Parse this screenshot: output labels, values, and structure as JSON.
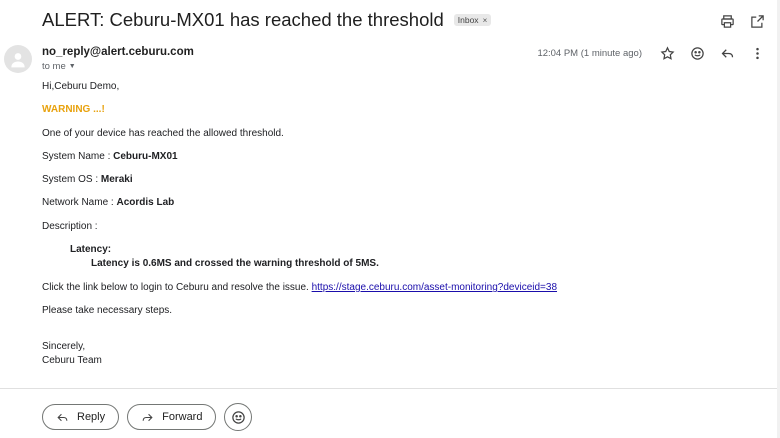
{
  "header": {
    "subject": "ALERT: Ceburu-MX01 has reached the threshold",
    "label_badge": "Inbox",
    "label_close": "×",
    "icons": [
      "print-icon",
      "open-in-new-window-icon"
    ]
  },
  "sender": {
    "email": "no_reply@alert.ceburu.com",
    "to_label": "to me",
    "time": "12:04 PM (1 minute ago)"
  },
  "body": {
    "greeting": "Hi,Ceburu Demo,",
    "warning": "WARNING ...!",
    "intro": "One of your device has reached the allowed threshold.",
    "system_name_label": "System Name : ",
    "system_name_value": "Ceburu-MX01",
    "system_os_label": "System OS : ",
    "system_os_value": "Meraki",
    "network_name_label": "Network Name : ",
    "network_name_value": "Acordis Lab",
    "description_label": "Description :",
    "latency_title": "Latency:",
    "latency_text": "Latency is 0.6MS and crossed the warning threshold of 5MS.",
    "link_prefix": "Click the link below to login to Ceburu and resolve the issue. ",
    "link_url": "https://stage.ceburu.com/asset-monitoring?deviceid=38",
    "steps": "Please take necessary steps.",
    "sign_off": "Sincerely,",
    "team": "Ceburu Team"
  },
  "actions": {
    "reply": "Reply",
    "forward": "Forward"
  },
  "colors": {
    "warning": "#e8a20e",
    "link": "#1a0dab"
  }
}
